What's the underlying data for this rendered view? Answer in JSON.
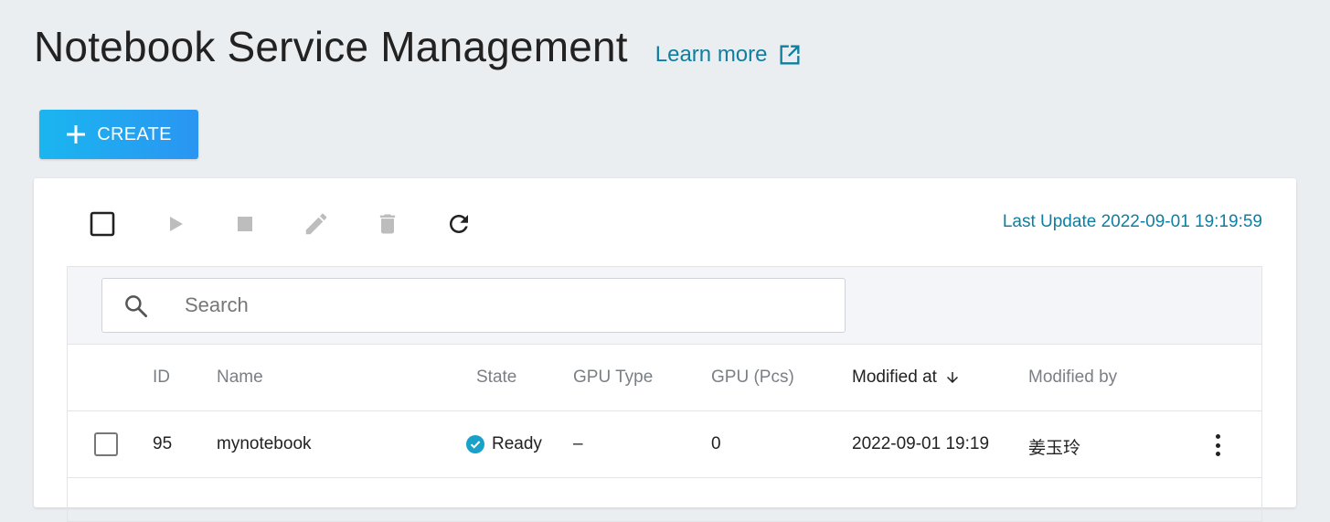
{
  "header": {
    "title": "Notebook Service Management",
    "learn_more": "Learn more"
  },
  "create_button": {
    "label": "CREATE"
  },
  "toolbar": {
    "last_update": "Last Update 2022-09-01 19:19:59"
  },
  "search": {
    "placeholder": "Search"
  },
  "table": {
    "columns": {
      "id": "ID",
      "name": "Name",
      "state": "State",
      "gpu_type": "GPU Type",
      "gpu_pcs": "GPU (Pcs)",
      "modified_at": "Modified at",
      "modified_by": "Modified by"
    },
    "rows": [
      {
        "id": "95",
        "name": "mynotebook",
        "state": "Ready",
        "gpu_type": "–",
        "gpu_pcs": "0",
        "modified_at": "2022-09-01 19:19",
        "modified_by": "姜玉玲"
      }
    ]
  },
  "colors": {
    "accent": "#0f7ea0",
    "button_gradient_start": "#1ab6f0",
    "button_gradient_end": "#2a95f2",
    "ready": "#1aa1c9",
    "disabled_icon": "#bdbdbd"
  }
}
